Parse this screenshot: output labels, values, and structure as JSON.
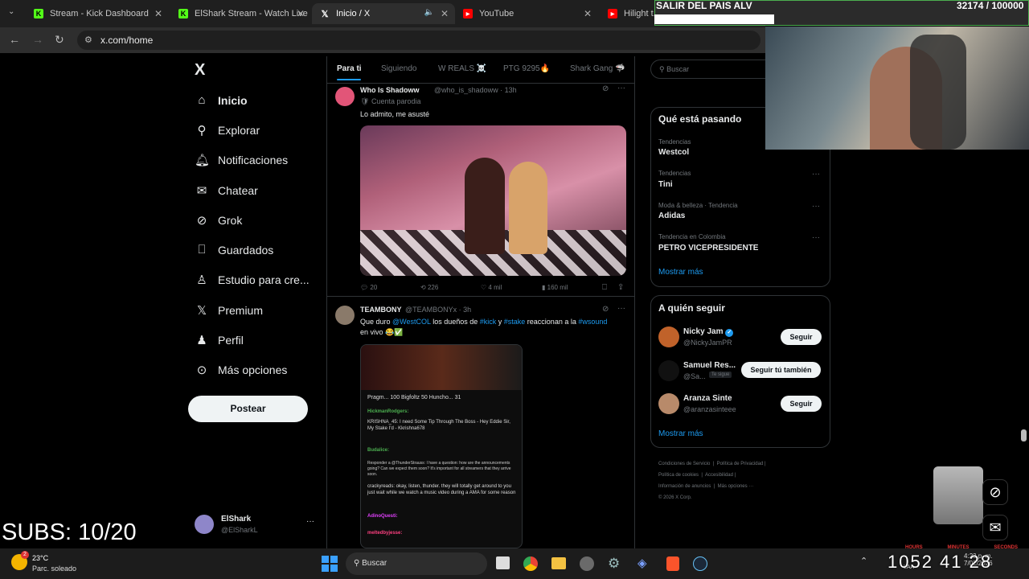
{
  "browser": {
    "tabs": [
      {
        "title": "Stream - Kick Dashboard",
        "icon": "kick-icon",
        "color": "#53fc18"
      },
      {
        "title": "ElShark Stream - Watch Live",
        "icon": "kick-icon",
        "color": "#53fc18"
      },
      {
        "title": "Inicio / X",
        "icon": "x-logo-icon",
        "color": "#ffffff"
      },
      {
        "title": "YouTube",
        "icon": "youtube-icon",
        "color": "#ff0000"
      },
      {
        "title": "Hilight t...",
        "icon": "youtube-icon",
        "color": "#ff0000"
      }
    ],
    "url": "x.com/home"
  },
  "overlay": {
    "top_banner": "SALIR DEL PAIS ALV",
    "top_counter": "32174 / 100000",
    "subs": "SUBS: 10/20",
    "big_timer": "1052 41 28",
    "timer_labels": [
      "HOURS",
      "MINUTES",
      "SECONDS"
    ]
  },
  "sidebar": {
    "logo": "X",
    "items": [
      {
        "label": "Inicio",
        "icon": "home-icon"
      },
      {
        "label": "Explorar",
        "icon": "search-icon"
      },
      {
        "label": "Notificaciones",
        "icon": "bell-icon"
      },
      {
        "label": "Chatear",
        "icon": "mail-icon"
      },
      {
        "label": "Grok",
        "icon": "grok-icon"
      },
      {
        "label": "Guardados",
        "icon": "bookmark-icon"
      },
      {
        "label": "Estudio para cre...",
        "icon": "creator-studio-icon"
      },
      {
        "label": "Premium",
        "icon": "x-logo-icon"
      },
      {
        "label": "Perfil",
        "icon": "person-icon"
      },
      {
        "label": "Más opciones",
        "icon": "more-circle-icon"
      }
    ],
    "post_button": "Postear",
    "account": {
      "name": "ElShark",
      "handle": "@ElSharkL"
    }
  },
  "timeline": {
    "tabs": [
      "Para ti",
      "Siguiendo",
      "W REALS ☠️",
      "PTG 9295🔥",
      "Shark Gang 🦈"
    ],
    "posts": [
      {
        "name": "Who Is Shadoww",
        "handle": "@who_is_shadoww · 13h",
        "tag": "Cuenta parodia",
        "text": "Lo admito, me asusté",
        "replies": "20",
        "reposts": "226",
        "likes": "4 mil",
        "views": "160 mil"
      },
      {
        "name": "TEAMBONY",
        "handle": "@TEAMBONYx · 3h",
        "text_parts": [
          "Que duro ",
          "@WestCOL",
          " los dueños de ",
          "#kick",
          " y ",
          "#stake",
          " reaccionan a la ",
          "#wsound",
          " en vivo 😂✅"
        ],
        "embed": {
          "header": [
            "Pragm...",
            "100",
            "Bigfoltz",
            "50",
            "Huncho...",
            "31"
          ],
          "lines": [
            "HickmanRodgers:",
            "KRISHNA_45: I need Some Tip Through The Boss - Hey Eddie Sir, My Stake I'd - Kkrishna678",
            "Budalice:",
            "Responder a @ThunderStrauss: I have a question: how are the announcements going? Can we expect them soon? It's important for all streamers that they arrive soon.",
            "crackyreads: okay, listen, thunder. they will totally get around to you just wait while we watch a music video during a AMA for some reason",
            "AdinoQuesti:",
            "meltedbyjesse:"
          ]
        }
      }
    ]
  },
  "right": {
    "search_placeholder": "Buscar",
    "trends_title": "Qué está pasando",
    "trends": [
      {
        "meta": "Tendencias",
        "name": "Westcol"
      },
      {
        "meta": "Tendencias",
        "name": "Tini"
      },
      {
        "meta": "Moda & belleza · Tendencia",
        "name": "Adidas"
      },
      {
        "meta": "Tendencia en Colombia",
        "name": "PETRO VICEPRESIDENTE"
      }
    ],
    "show_more": "Mostrar más",
    "follow_title": "A quién seguir",
    "follow": [
      {
        "name": "Nicky Jam",
        "handle": "@NickyJamPR",
        "button": "Seguir"
      },
      {
        "name": "Samuel Res...",
        "handle": "@Sa...",
        "badge": "Te sigue",
        "button": "Seguir tú también"
      },
      {
        "name": "Aranza Sinte",
        "handle": "@aranzasinteee",
        "button": "Seguir"
      }
    ],
    "footer": [
      "Condiciones de Servicio",
      "Política de Privacidad",
      "Política de cookies",
      "Accesibilidad",
      "Información de anuncios",
      "Más opciones ···",
      "© 2026 X Corp."
    ]
  },
  "taskbar": {
    "weather_temp": "23°C",
    "weather_desc": "Parc. soleado",
    "search": "Buscar",
    "time": "4:23 p. m.",
    "date": "7/02/2026",
    "lang": "LAA"
  },
  "colors": {
    "accent": "#1d9bf0",
    "kick": "#53fc18",
    "overlay_green": "#4caf50"
  }
}
